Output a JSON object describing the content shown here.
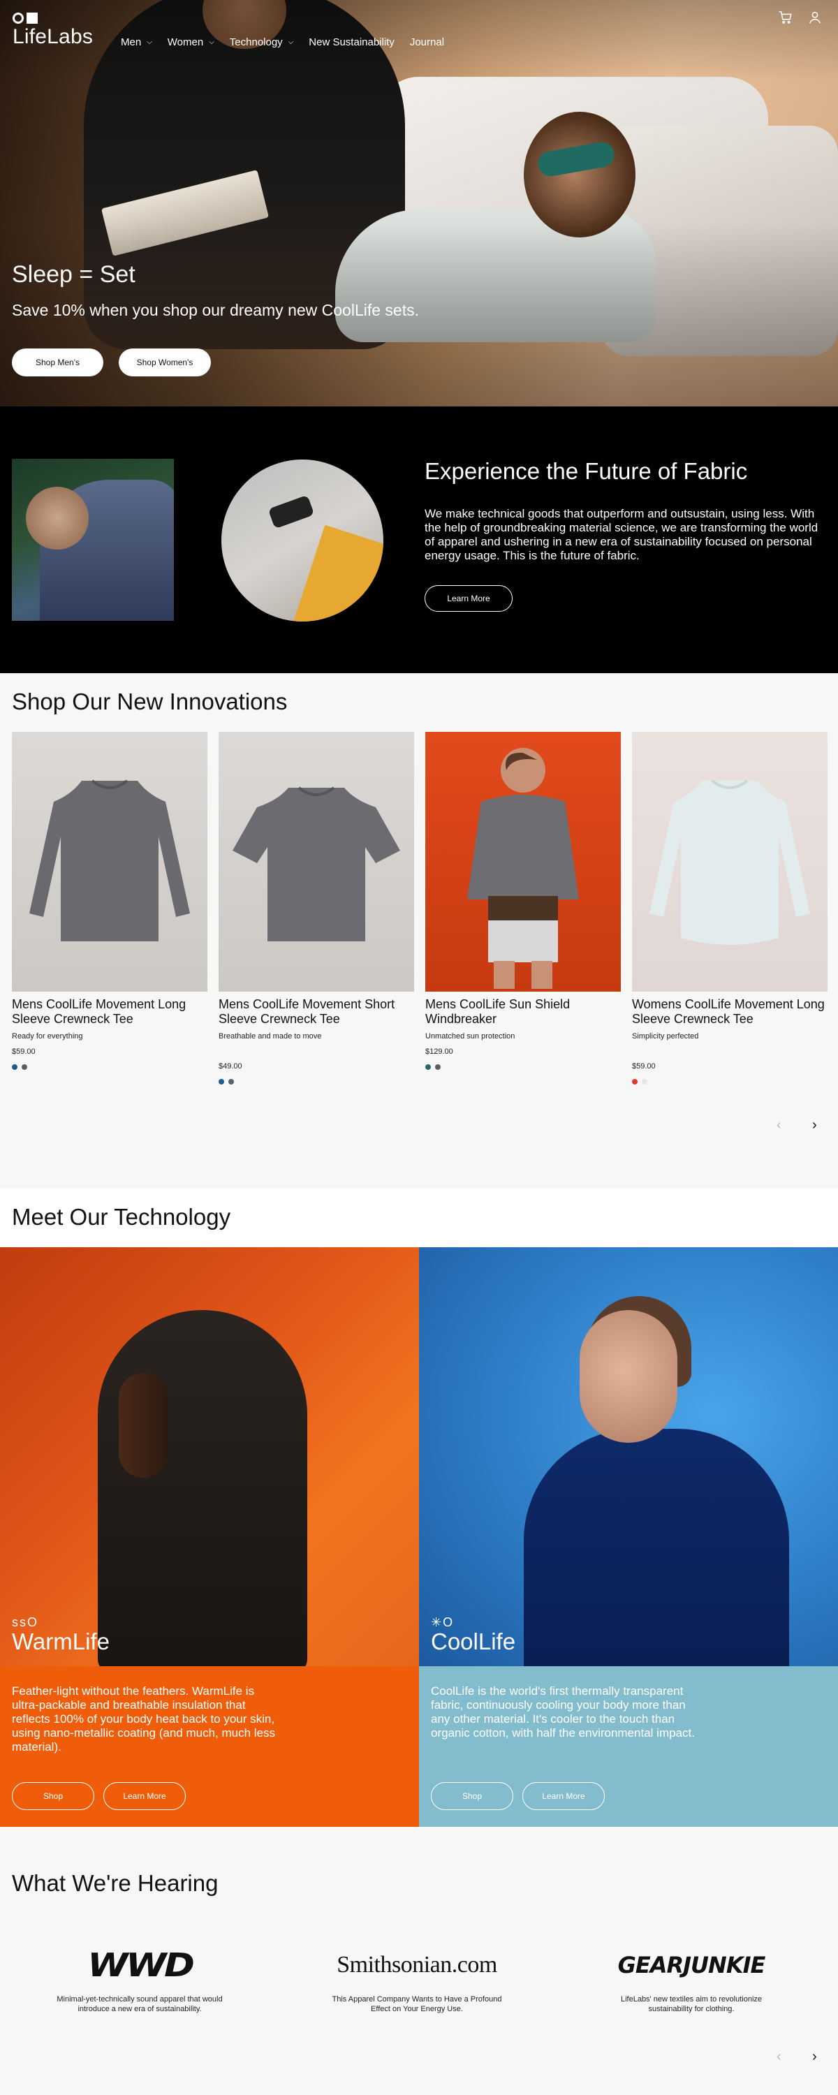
{
  "header": {
    "brand": "LifeLabs",
    "nav": [
      {
        "label": "Men",
        "dropdown": true
      },
      {
        "label": "Women",
        "dropdown": true
      },
      {
        "label": "Technology",
        "dropdown": true
      },
      {
        "label": "New Sustainability",
        "dropdown": false
      },
      {
        "label": "Journal",
        "dropdown": false
      }
    ],
    "icons": [
      "cart-icon",
      "account-icon"
    ]
  },
  "hero": {
    "title": "Sleep = Set",
    "subtitle": "Save 10% when you shop our dreamy new CoolLife sets.",
    "buttons": [
      "Shop Men's",
      "Shop Women's"
    ]
  },
  "fabric": {
    "title": "Experience the Future of Fabric",
    "body": "We make technical goods that outperform and outsustain, using less. With the help of groundbreaking material science, we are transforming the world of apparel and ushering in a new era of sustainability focused on personal energy usage. This is the future of fabric.",
    "button": "Learn More"
  },
  "innovations": {
    "title": "Shop Our New Innovations",
    "products": [
      {
        "name": "Mens CoolLife Movement Long Sleeve Crewneck Tee",
        "tagline": "Ready for everything",
        "price": "$59.00",
        "swatches": [
          "#1f5a8c",
          "#5a6068"
        ]
      },
      {
        "name": "Mens CoolLife Movement Short Sleeve Crewneck Tee",
        "tagline": "Breathable and made to move",
        "price": "$49.00",
        "swatches": [
          "#1f5a8c",
          "#5a6068"
        ]
      },
      {
        "name": "Mens CoolLife Sun Shield Windbreaker",
        "tagline": "Unmatched sun protection",
        "price": "$129.00",
        "swatches": [
          "#2b6a6a",
          "#5a6068"
        ]
      },
      {
        "name": "Womens CoolLife Movement Long Sleeve Crewneck Tee",
        "tagline": "Simplicity perfected",
        "price": "$59.00",
        "swatches": [
          "#e03a2c",
          "#e6e6e6"
        ]
      }
    ],
    "prev_arrow": "‹",
    "next_arrow": "›"
  },
  "technology": {
    "title": "Meet Our Technology",
    "items": [
      {
        "mark": "ssO",
        "name": "WarmLife",
        "desc": "Feather-light without the feathers. WarmLife is ultra-packable and breathable insulation that reflects 100% of your body heat back to your skin, using nano-metallic coating (and much, much less material).",
        "shop": "Shop",
        "learn": "Learn More"
      },
      {
        "mark": "✳O",
        "name": "CoolLife",
        "desc": "CoolLife is the world's first thermally transparent fabric, continuously cooling your body more than any other material. It's cooler to the touch than organic cotton, with half the environmental impact.",
        "shop": "Shop",
        "learn": "Learn More"
      }
    ]
  },
  "press": {
    "title": "What We're Hearing",
    "items": [
      {
        "logo": "WWD",
        "quote": "Minimal-yet-technically sound apparel that would introduce a new era of sustainability."
      },
      {
        "logo": "Smithsonian.com",
        "quote": "This Apparel Company Wants to Have a Profound Effect on Your Energy Use."
      },
      {
        "logo": "GEARJUNKIE",
        "quote": "LifeLabs' new textiles aim to revolutionize sustainability for clothing."
      }
    ],
    "prev_arrow": "‹",
    "next_arrow": "›"
  }
}
